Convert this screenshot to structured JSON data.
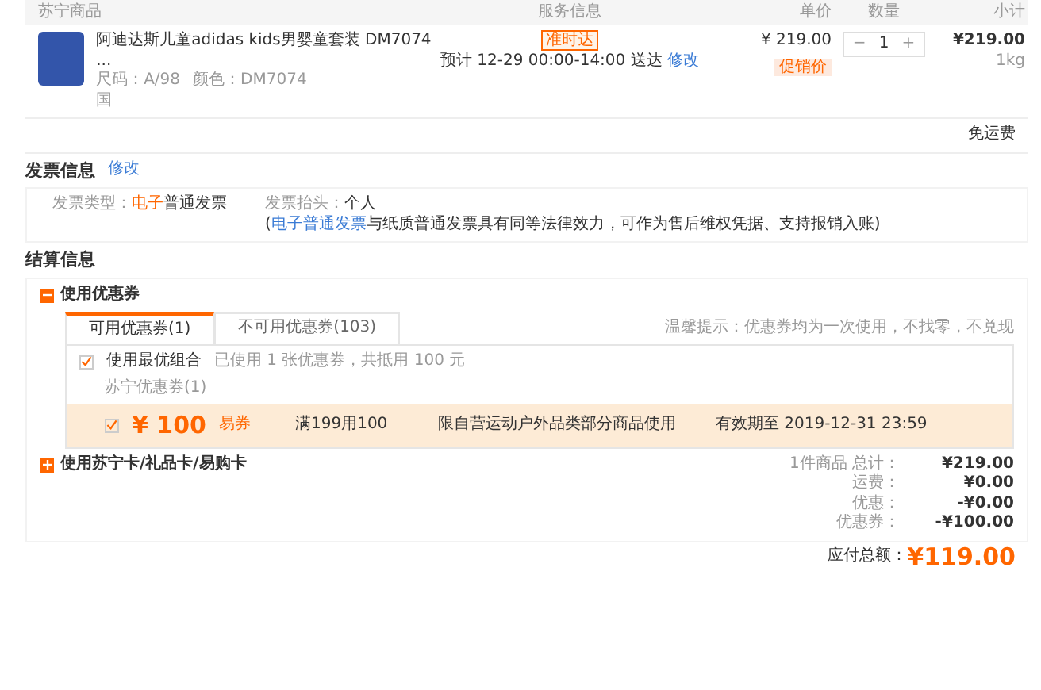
{
  "goods_header": {
    "columns": [
      "苏宁商品",
      "服务信息",
      "单价",
      "数量",
      "小计"
    ]
  },
  "item": {
    "title": "阿迪达斯儿童adidas kids男婴童套装 DM7074 ...",
    "size": "尺码：A/98",
    "color_label": "颜色：DM7074",
    "tag": "国",
    "badge": "准时达",
    "delivery": "预计 12-29 00:00-14:00 送达",
    "delivery_link": "修改",
    "price": "¥ 219.00",
    "price_tag": "促销价",
    "quantity": "1",
    "minus": "−",
    "plus": "+",
    "subtotal": "¥219.00",
    "weight": "1kg"
  },
  "shipping_note": "免运费",
  "invoice": {
    "title": "发票信息",
    "edit": "修改",
    "type_label": "发票类型：",
    "type_value_highlight": "电子",
    "type_value": "普通发票",
    "head_label": "发票抬头：",
    "head_value": "个人",
    "note": "(**电子普通发票**与纸质普通发票具有同等法律效力，可作为售后维权凭据、支持报销入账)"
  },
  "settlement": {
    "title": "结算信息",
    "coupon_section": {
      "label": "使用优惠券",
      "expanded": true,
      "tabs": [
        {
          "label": "可用优惠券(1)",
          "selected": true
        },
        {
          "label": "不可用优惠券(103)",
          "selected": false
        }
      ],
      "tip": "温馨提示：优惠券均为一次使用，不找零，不兑现",
      "best_combo": {
        "checked": true,
        "label": "使用最优组合",
        "summary": "已使用 1 张优惠券，共抵用 100 元"
      },
      "group": "苏宁优惠券(1)",
      "coupons": [
        {
          "checked": true,
          "currency": "¥",
          "amount": "100",
          "type": "易券",
          "condition": "满199用100",
          "scope": "限自营运动户外品类部分商品使用",
          "expiry": "有效期至 2019-12-31 23:59"
        }
      ]
    },
    "card_section": {
      "label": "使用苏宁卡/礼品卡/易购卡",
      "expanded": false
    },
    "summary": [
      {
        "label": "1件商品 总计：",
        "value": "¥219.00"
      },
      {
        "label": "运费：",
        "value": "¥0.00"
      },
      {
        "label": "优惠：",
        "value": "-¥0.00"
      },
      {
        "label": "优惠券：",
        "value": "-¥100.00"
      }
    ],
    "total": {
      "label": "应付总额：",
      "value": "¥119.00"
    }
  }
}
